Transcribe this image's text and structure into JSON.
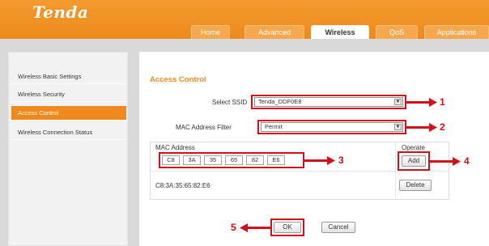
{
  "header": {
    "logo": "Tenda",
    "tabs": [
      {
        "label": "Home"
      },
      {
        "label": "Advanced"
      },
      {
        "label": "Wireless",
        "active": true
      },
      {
        "label": "QoS"
      },
      {
        "label": "Applications"
      }
    ]
  },
  "sidebar": {
    "items": [
      {
        "label": "Wireless Basic Settings"
      },
      {
        "label": "Wireless Security"
      },
      {
        "label": "Access Control",
        "active": true
      },
      {
        "label": "Wireless Connection Status"
      }
    ]
  },
  "main": {
    "title": "Access Control",
    "ssid": {
      "label": "Select SSID",
      "value": "Tenda_DDF0E8"
    },
    "mac_filter": {
      "label": "MAC Address Filter",
      "value": "Permit"
    },
    "table": {
      "mac_header": "MAC Address",
      "operate_header": "Operate",
      "mac_inputs": [
        "C8",
        "3A",
        "35",
        "65",
        "82",
        "E6"
      ],
      "add_label": "Add",
      "rows": [
        {
          "mac": "C8:3A:35:65:82:E6",
          "action": "Delete"
        }
      ]
    },
    "ok_label": "OK",
    "cancel_label": "Cancel"
  },
  "annotations": {
    "markers": [
      "1",
      "2",
      "3",
      "4",
      "5"
    ],
    "color": "#d0101a"
  },
  "colors": {
    "brand_orange": "#f08a1e",
    "page_gray": "#d9d9d9"
  },
  "icons": {
    "select_dropdown": "chevron-down-icon",
    "annotation_arrow": "arrow-icon"
  }
}
